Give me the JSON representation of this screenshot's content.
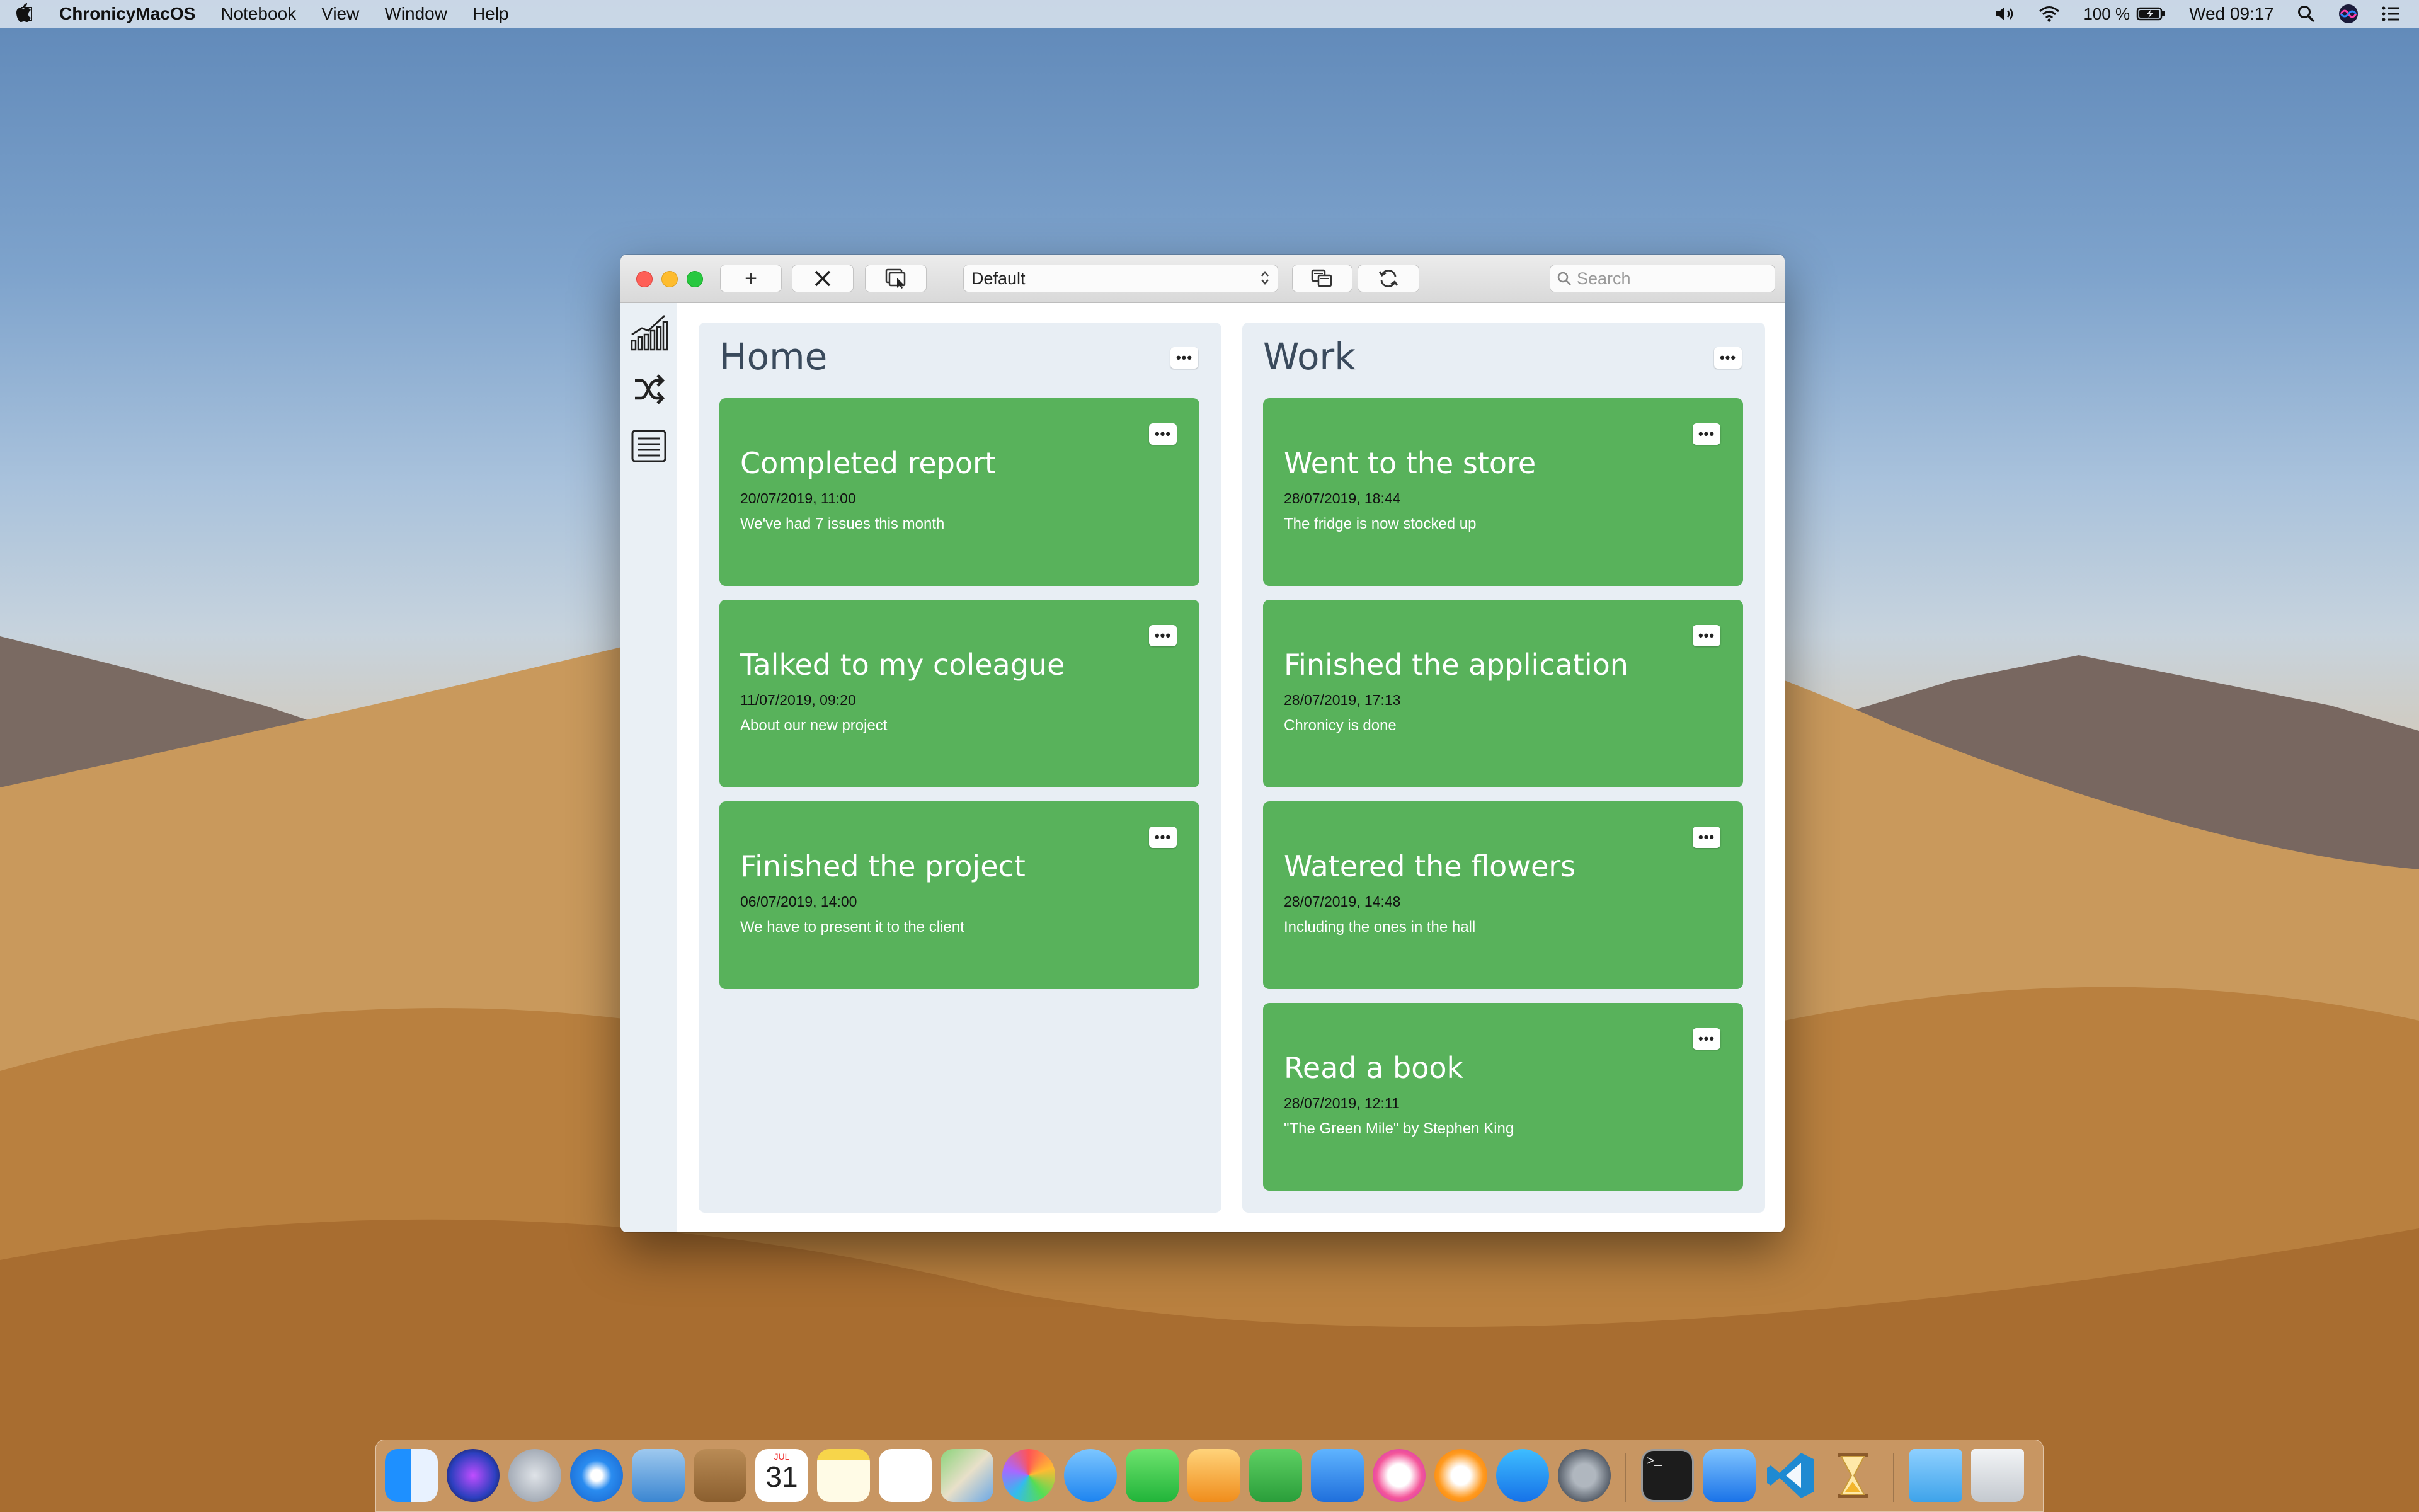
{
  "menubar": {
    "app_name": "ChronicyMacOS",
    "menus": [
      "Notebook",
      "View",
      "Window",
      "Help"
    ],
    "battery": "100 %",
    "clock": "Wed 09:17"
  },
  "toolbar": {
    "add_label": "+",
    "delete_label": "✕",
    "notebook_select": "Default",
    "search_placeholder": "Search"
  },
  "sidebar": {
    "items": [
      {
        "icon": "chart-icon"
      },
      {
        "icon": "shuffle-icon"
      },
      {
        "icon": "list-icon"
      }
    ]
  },
  "columns": [
    {
      "title": "Home",
      "menu_label": "•••",
      "cards": [
        {
          "title": "Completed report",
          "date": "20/07/2019, 11:00",
          "desc": "We've had 7 issues this month",
          "menu_label": "•••"
        },
        {
          "title": "Talked to my coleague",
          "date": "11/07/2019, 09:20",
          "desc": "About our new project",
          "menu_label": "•••"
        },
        {
          "title": "Finished the project",
          "date": "06/07/2019, 14:00",
          "desc": "We have to present it to the client",
          "menu_label": "•••"
        }
      ]
    },
    {
      "title": "Work",
      "menu_label": "•••",
      "cards": [
        {
          "title": "Went to the store",
          "date": "28/07/2019, 18:44",
          "desc": "The fridge is now stocked up",
          "menu_label": "•••"
        },
        {
          "title": "Finished the application",
          "date": "28/07/2019, 17:13",
          "desc": "Chronicy is done",
          "menu_label": "•••"
        },
        {
          "title": "Watered the flowers",
          "date": "28/07/2019, 14:48",
          "desc": "Including the ones in the hall",
          "menu_label": "•••"
        },
        {
          "title": "Read a book",
          "date": "28/07/2019, 12:11",
          "desc": "\"The Green Mile\" by Stephen King",
          "menu_label": "•••"
        }
      ]
    }
  ],
  "dock": {
    "icons": [
      "finder-icon",
      "siri-icon",
      "launchpad-icon",
      "safari-icon",
      "mail-icon",
      "contacts-icon",
      "calendar-icon",
      "notes-icon",
      "reminders-icon",
      "maps-icon",
      "photos-icon",
      "messages-icon",
      "facetime-icon",
      "pages-icon",
      "numbers-icon",
      "keynote-icon",
      "music-icon",
      "books-icon",
      "app-store-icon",
      "system-preferences-icon",
      "terminal-icon",
      "xcode-icon",
      "vscode-icon",
      "chronicy-icon",
      "downloads-icon",
      "trash-icon"
    ],
    "calendar_month": "JUL",
    "calendar_day": "31"
  },
  "colors": {
    "card_green": "#58b25b",
    "column_bg": "#e8eef4",
    "title_color": "#3a4a5c"
  }
}
